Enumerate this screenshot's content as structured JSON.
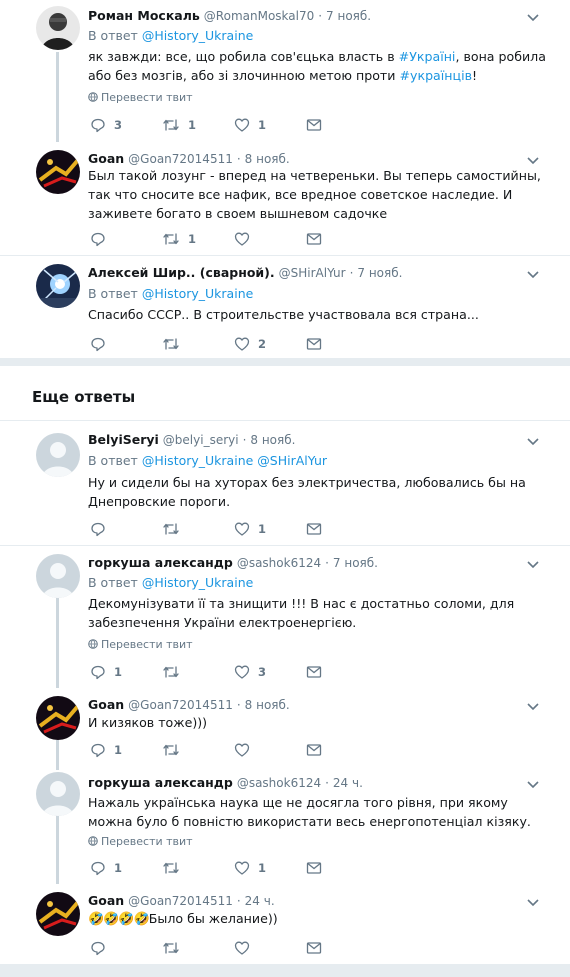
{
  "tweets": [
    {
      "name": "Роман Москаль",
      "handle": "@RomanMoskal70",
      "time": "7 нояб.",
      "reply_prefix": "В ответ",
      "reply_to": "@History_Ukraine",
      "text_parts": [
        "як завжди: все, що робила сов'єцька власть в ",
        "#Україні",
        ", вона робила або без мозгів, або зі злочинною метою проти ",
        "#українців",
        "!"
      ],
      "translate": "Перевести твит",
      "replies": "3",
      "retweets": "1",
      "likes": "1"
    },
    {
      "name": "Goan",
      "handle": "@Goan72014511",
      "time": "8 нояб.",
      "text": "Был такой лозунг - вперед на четвереньки. Вы теперь самостийны, так что сносите все нафик, все вредное советское наследие. И заживете богато в своем вышневом садочке",
      "replies": "",
      "retweets": "1",
      "likes": ""
    },
    {
      "name": "Алексей Шир.. (сварной).",
      "handle": "@SHirAlYur",
      "time": "7 нояб.",
      "reply_prefix": "В ответ",
      "reply_to": "@History_Ukraine",
      "text": "Спасибо СССР.. В строительстве участвовала вся страна...",
      "replies": "",
      "retweets": "",
      "likes": "2"
    }
  ],
  "more_replies_title": "Еще ответы",
  "more": [
    {
      "name": "BelyiSeryi",
      "handle": "@belyi_seryi",
      "time": "8 нояб.",
      "reply_prefix": "В ответ",
      "reply_to": "@History_Ukraine @SHirAlYur",
      "text": "Ну и сидели бы на хуторах без электричества, любовались бы на Днепровские пороги.",
      "replies": "",
      "retweets": "",
      "likes": "1"
    },
    {
      "name": "горкуша александр",
      "handle": "@sashok6124",
      "time": "7 нояб.",
      "reply_prefix": "В ответ",
      "reply_to": "@History_Ukraine",
      "text": "Декомунізувати її та знищити !!! В нас є достатньо соломи, для забезпечення України електроенергією.",
      "translate": "Перевести твит",
      "replies": "1",
      "retweets": "",
      "likes": "3"
    },
    {
      "name": "Goan",
      "handle": "@Goan72014511",
      "time": "8 нояб.",
      "text": "И кизяков тоже)))",
      "replies": "1",
      "retweets": "",
      "likes": ""
    },
    {
      "name": "горкуша александр",
      "handle": "@sashok6124",
      "time": "24 ч.",
      "text": "Нажаль українська наука ще не досягла того рівня, при якому можна було б повністю використати весь енергопотенціал кізяку.",
      "translate": "Перевести твит",
      "replies": "1",
      "retweets": "",
      "likes": "1"
    },
    {
      "name": "Goan",
      "handle": "@Goan72014511",
      "time": "24 ч.",
      "emoji": "🤣🤣🤣🤣",
      "text": "Было бы желание))",
      "replies": "",
      "retweets": "",
      "likes": ""
    }
  ],
  "colors": {
    "link": "#1b95e0",
    "muted": "#657786",
    "thread": "#ccd6dd",
    "background": "#e6ecf0"
  },
  "icons": [
    "reply-icon",
    "retweet-icon",
    "like-icon",
    "dm-icon",
    "caret-down-icon",
    "globe-icon"
  ]
}
